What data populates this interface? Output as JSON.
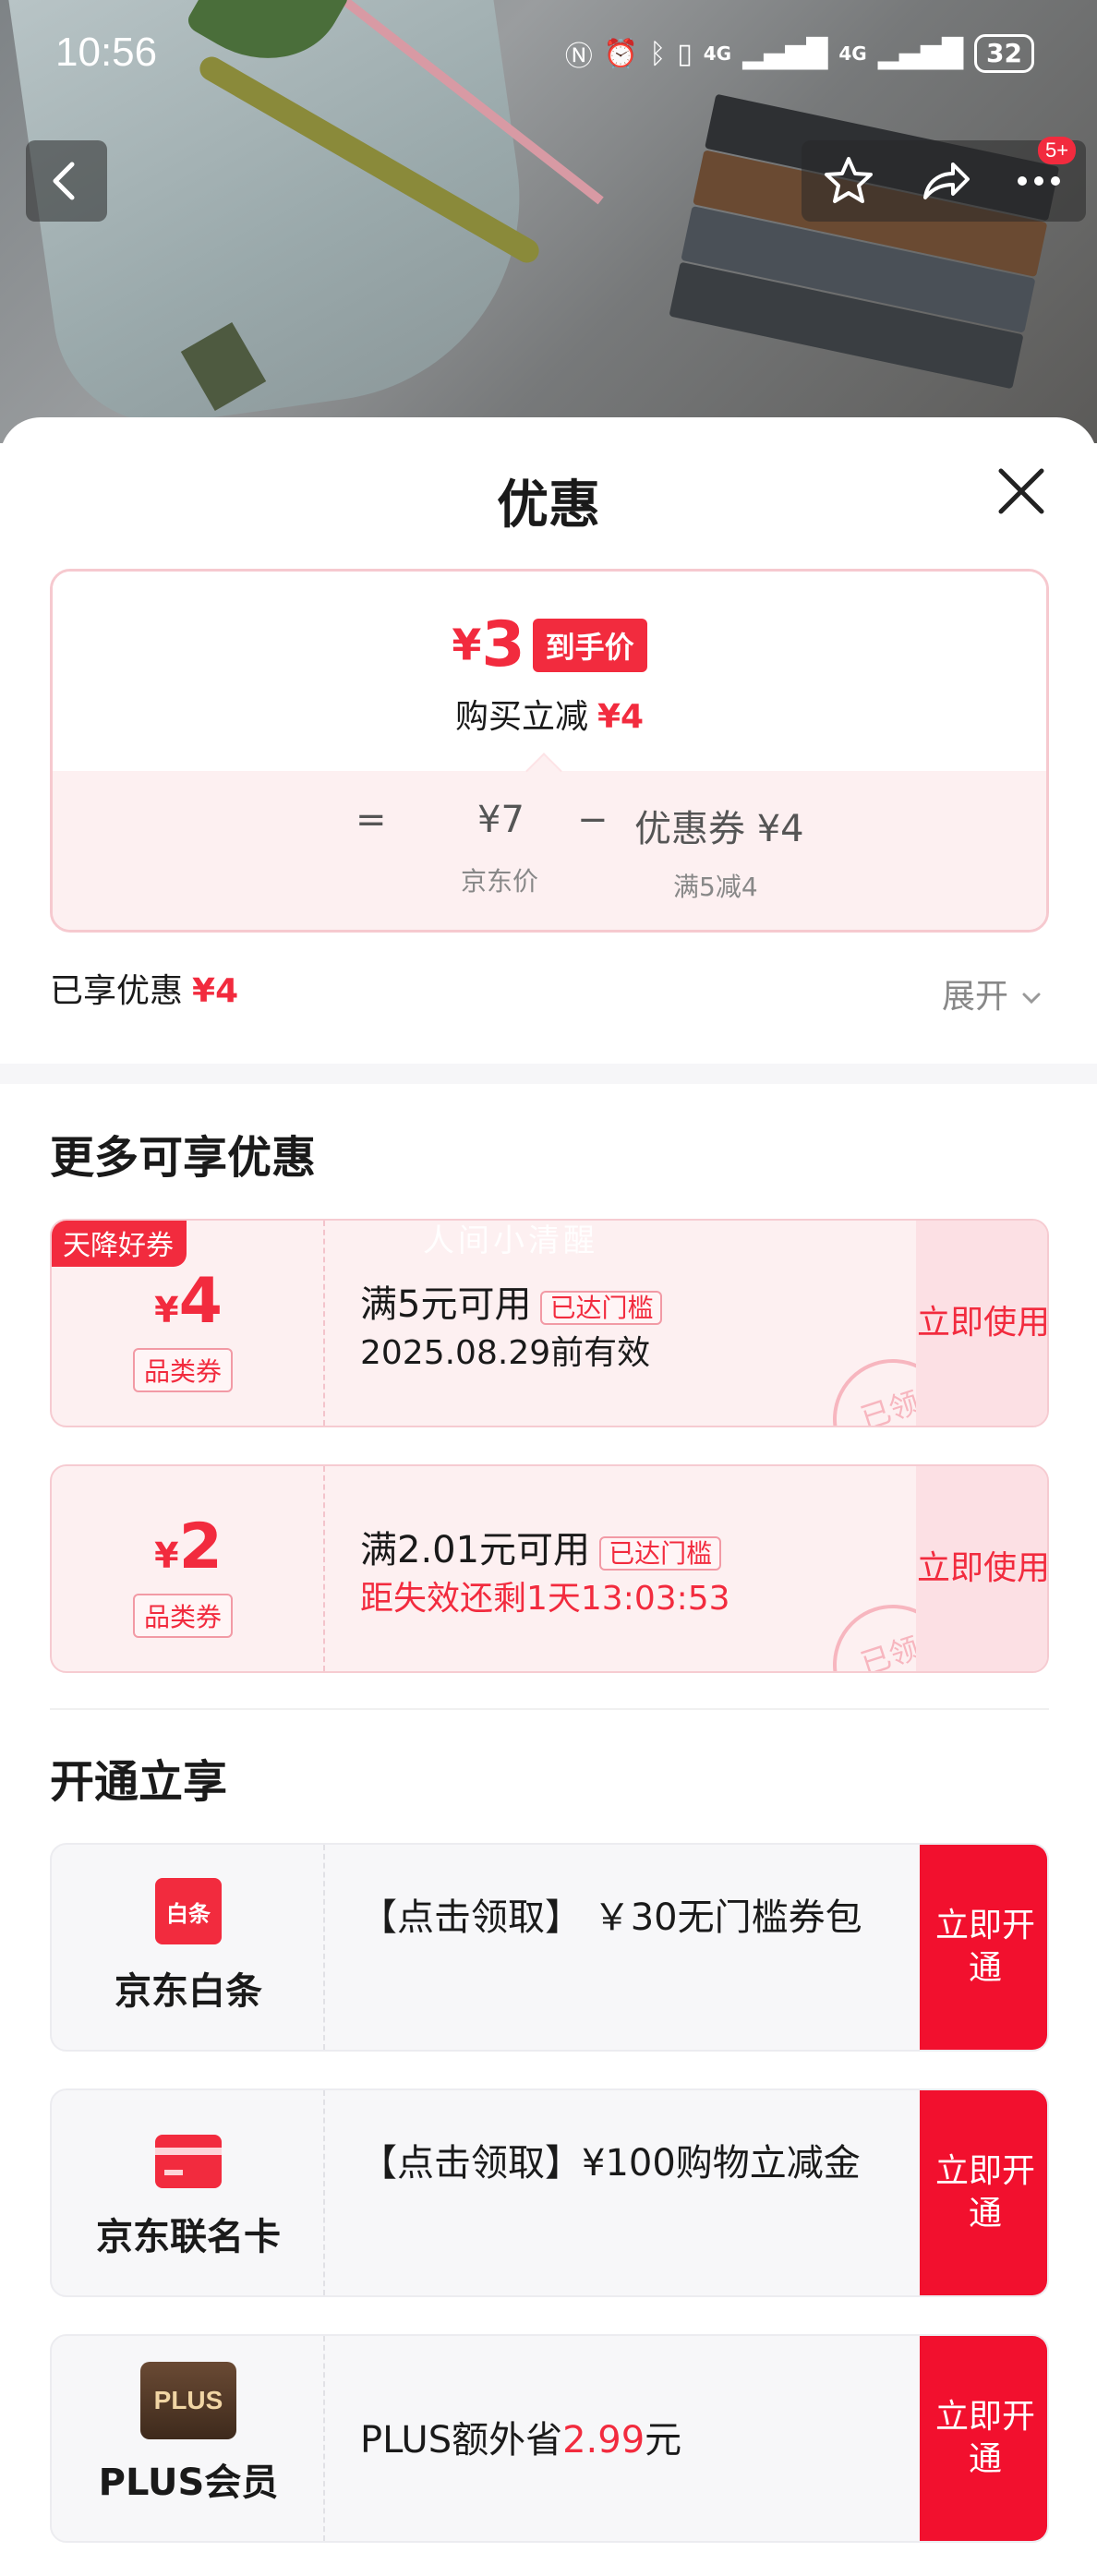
{
  "status": {
    "time": "10:56",
    "battery": "32",
    "net1": "4G",
    "net2": "4G"
  },
  "nav": {
    "badge": "5+"
  },
  "sheet": {
    "title": "优惠"
  },
  "price": {
    "currency": "¥",
    "final": "3",
    "final_tag": "到手价",
    "reduce_label": "购买立减",
    "reduce_value": "¥4",
    "equals": "=",
    "jd_price": "¥7",
    "jd_price_label": "京东价",
    "minus": "−",
    "coupon_label": "优惠券 ¥4",
    "coupon_cond": "满5减4"
  },
  "enjoyed": {
    "label": "已享优惠",
    "value": "¥4",
    "expand": "展开"
  },
  "more_title": "更多可享优惠",
  "watermark": "人间小清醒",
  "coupons": [
    {
      "flag": "天降好券",
      "currency": "¥",
      "amount": "4",
      "category": "品类券",
      "condition": "满5元可用",
      "reached": "已达门槛",
      "validity": "2025.08.29前有效",
      "use": "立即使用",
      "stamp": "已领"
    },
    {
      "currency": "¥",
      "amount": "2",
      "category": "品类券",
      "condition": "满2.01元可用",
      "reached": "已达门槛",
      "validity": "距失效还剩1天13:03:53",
      "use": "立即使用",
      "stamp": "已领"
    }
  ],
  "open_title": "开通立享",
  "cards": [
    {
      "name": "京东白条",
      "logo_text": "白条",
      "desc": "【点击领取】 ￥30无门槛券包",
      "action": "立即开通"
    },
    {
      "name": "京东联名卡",
      "desc": "【点击领取】¥100购物立减金",
      "action": "立即开通"
    },
    {
      "name": "PLUS会员",
      "logo_text": "PLUS",
      "desc_prefix": "PLUS额外省",
      "desc_value": "2.99",
      "desc_suffix": "元",
      "action": "立即开通"
    }
  ],
  "colors": {
    "accent": "#f22b3e",
    "coupon_bg": "#fdf0f1"
  }
}
